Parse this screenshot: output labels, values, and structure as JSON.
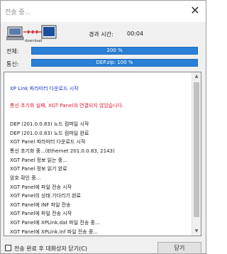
{
  "window": {
    "title": "전송 중...",
    "close_glyph": "✕"
  },
  "icon": {
    "name": "transfer-icon",
    "caption": "download"
  },
  "elapsed": {
    "label": "경과 시간:",
    "value": "00:04"
  },
  "overall": {
    "label": "전체:",
    "percent": 200,
    "text": "200 %"
  },
  "comm": {
    "label": "통신:",
    "percent": 100,
    "text": "DEP.zip: 100 %"
  },
  "log": {
    "lines": [
      {
        "text": "XP Link 파라미터 다운로드 시작",
        "color": "blue"
      },
      {
        "text": "통신 초기화 실패, XGT Panel과 연결되지 않았습니다.",
        "color": "red"
      },
      {
        "text": "DEP (201.0.0.83) 노드 컴파일 시작",
        "color": "black"
      },
      {
        "text": "DEP (201.0.0.83) 노드 컴파일 완료",
        "color": "black"
      },
      {
        "text": "XGT Panel 파라미터 다운로드 시작",
        "color": "black"
      },
      {
        "text": "통신 초기화 중...(Ethernet 201.0.0.83, 2143)",
        "color": "black"
      },
      {
        "text": "XGT Panel 정보 읽는 중...",
        "color": "black"
      },
      {
        "text": "XGT Panel 정보 읽기 완료",
        "color": "black"
      },
      {
        "text": "암호 확인 중...",
        "color": "black"
      },
      {
        "text": "XGT Panel에 파일 전송 시작",
        "color": "black"
      },
      {
        "text": "XGT Panel의 상태 기다리기 완료",
        "color": "black"
      },
      {
        "text": "XGT Panel에 INF 파일 전송",
        "color": "black"
      },
      {
        "text": "XGT Panel에 파일 전송 시작",
        "color": "black"
      },
      {
        "text": "XGT Panel에 XPLink.dat 파일 전송 중...",
        "color": "black"
      },
      {
        "text": "XGT Panel에 XPLink.inf 파일 전송 중...",
        "color": "black"
      }
    ]
  },
  "footer": {
    "checkbox_label": "전송 완료 후 대화상자 닫기(C)",
    "checkbox_checked": false,
    "close_button": "닫기"
  }
}
